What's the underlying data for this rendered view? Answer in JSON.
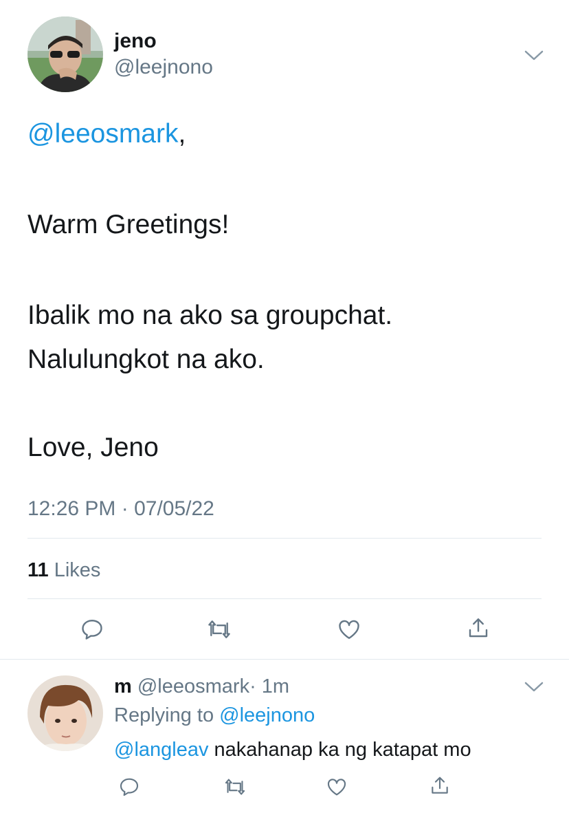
{
  "tweet": {
    "author": {
      "name": "jeno",
      "handle": "@leejnono"
    },
    "mention": "@leeosmark",
    "mention_suffix": ",",
    "lines": [
      "Warm Greetings!",
      "Ibalik mo na ako sa groupchat.",
      "Nalulungkot na ako.",
      "Love, Jeno"
    ],
    "timestamp": "12:26 PM · 07/05/22",
    "likes_count": "11",
    "likes_label": "Likes"
  },
  "reply": {
    "author": {
      "name": "m",
      "handle": "@leeosmark",
      "time": "· 1m"
    },
    "replying_prefix": "Replying to",
    "replying_handle": "@leejnono",
    "mention": "@langleav",
    "text": " nakahanap ka ng katapat mo"
  },
  "icons": {
    "reply": "reply-icon",
    "retweet": "retweet-icon",
    "like": "heart-icon",
    "share": "share-icon",
    "menu": "chevron-down-icon"
  },
  "colors": {
    "accent": "#1b95e0",
    "muted": "#657786",
    "text": "#14171a",
    "divider": "#e1e8ed"
  }
}
